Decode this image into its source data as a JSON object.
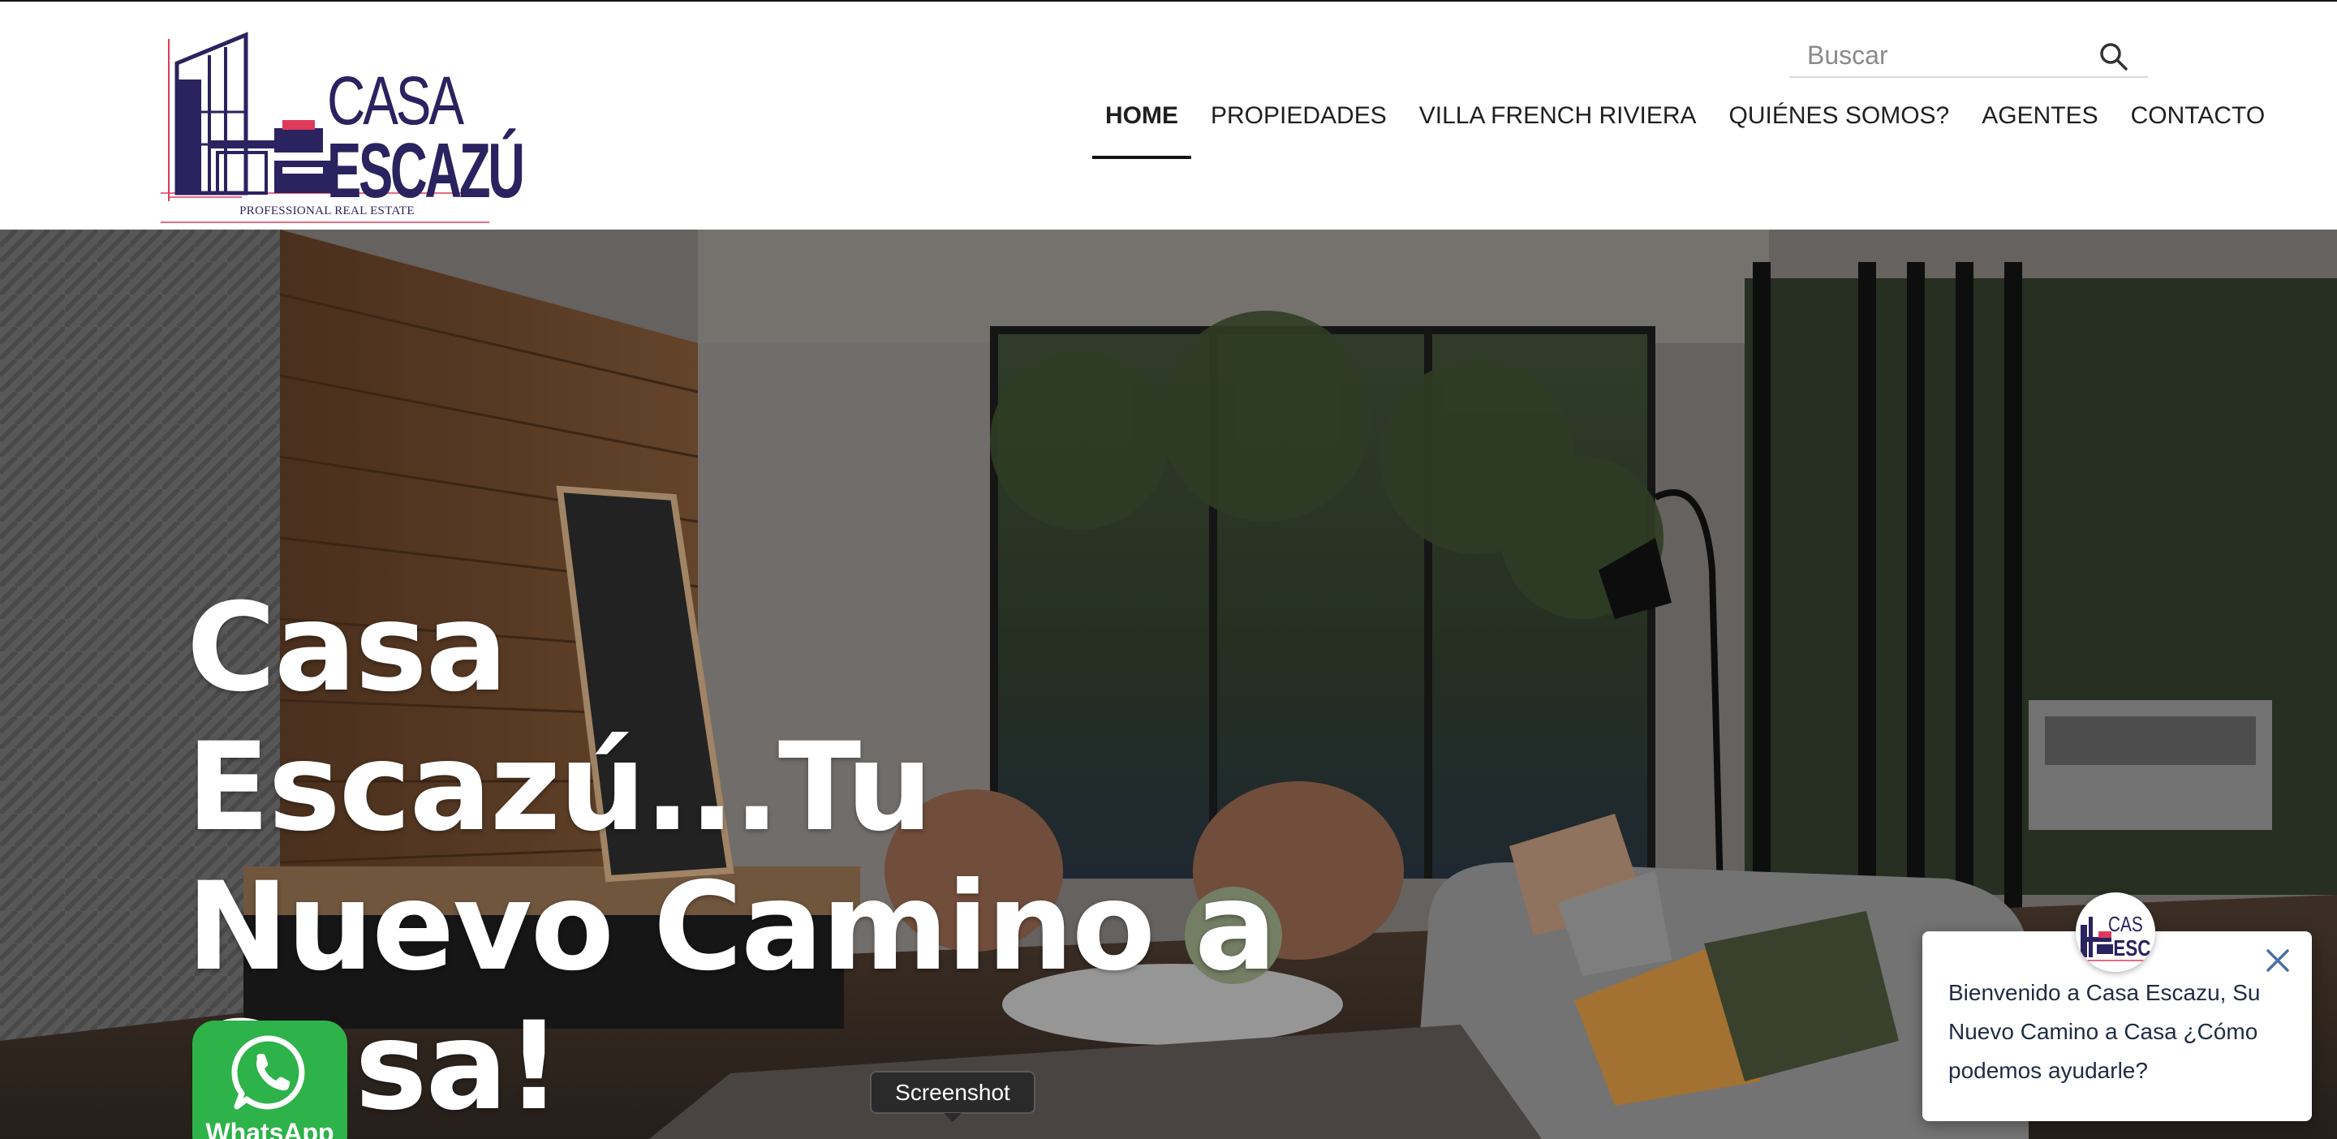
{
  "header": {
    "logo": {
      "line1": "CASA",
      "line2": "ESCAZÚ",
      "tagline": "PROFESSIONAL REAL ESTATE",
      "brand_color": "#2b2260",
      "accent_color": "#e03a5b"
    },
    "search": {
      "placeholder": "Buscar",
      "icon": "search-icon"
    },
    "nav": [
      {
        "label": "HOME",
        "active": true
      },
      {
        "label": "PROPIEDADES",
        "active": false
      },
      {
        "label": "VILLA FRENCH RIVIERA",
        "active": false
      },
      {
        "label": "QUIÉNES SOMOS?",
        "active": false
      },
      {
        "label": "AGENTES",
        "active": false
      },
      {
        "label": "CONTACTO",
        "active": false
      }
    ]
  },
  "hero": {
    "title_line1": "Casa Escazú...Tu",
    "title_line2": "Nuevo Camino a",
    "title_line3": "Casa!"
  },
  "whatsapp": {
    "label": "WhatsApp",
    "color": "#2eb24a",
    "icon": "whatsapp-icon"
  },
  "tooltip": {
    "label": "Screenshot"
  },
  "chat": {
    "message": "Bienvenido a Casa Escazu, Su Nuevo Camino a Casa ¿Cómo podemos ayudarle?",
    "avatar_text": "CASA ESCAZÚ",
    "close_icon": "close-icon"
  }
}
